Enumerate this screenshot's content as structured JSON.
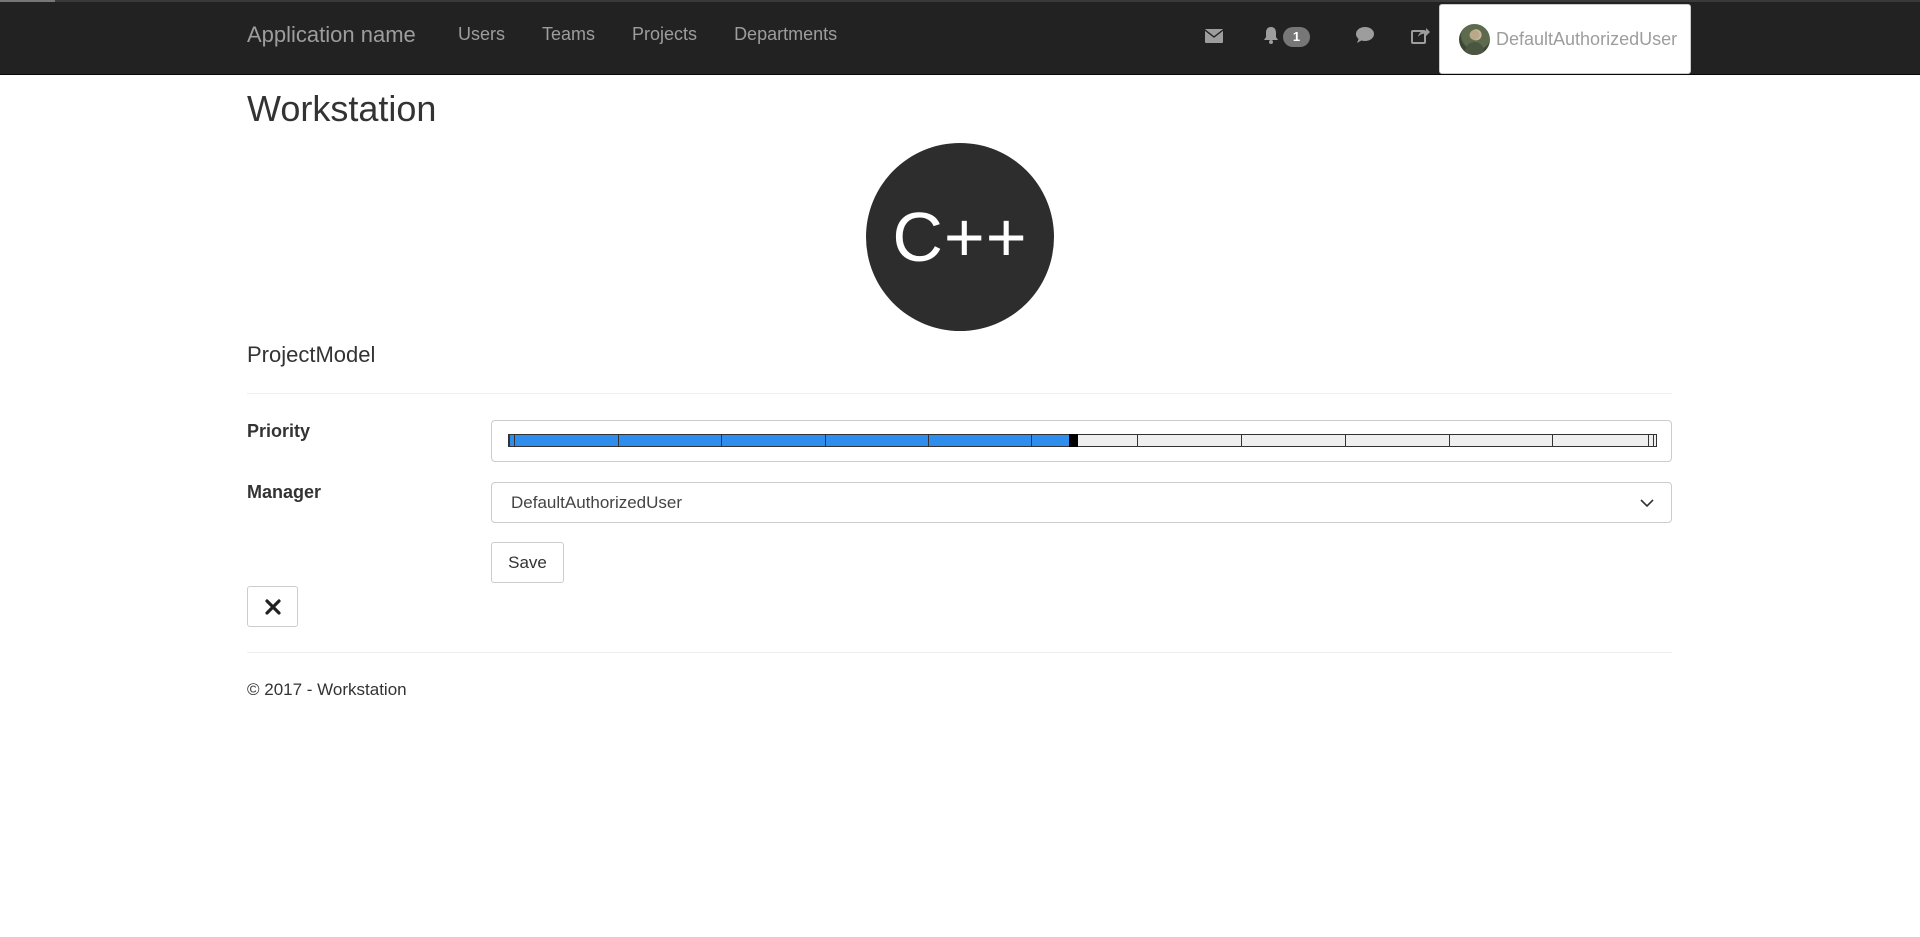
{
  "navbar": {
    "brand": "Application name",
    "links": [
      "Users",
      "Teams",
      "Projects",
      "Departments"
    ],
    "icons": [
      "envelope-icon",
      "bell-icon",
      "comment-icon",
      "share-icon"
    ],
    "notification_count": "1",
    "user_name": "DefaultAuthorizedUser"
  },
  "page": {
    "title": "Workstation",
    "project_initials": "C++",
    "section_title": "ProjectModel"
  },
  "form": {
    "priority_label": "Priority",
    "priority": {
      "value": 6,
      "max": 12,
      "segments": 11
    },
    "manager_label": "Manager",
    "manager_value": "DefaultAuthorizedUser",
    "save_label": "Save"
  },
  "footer": {
    "text": "© 2017 - Workstation"
  },
  "colors": {
    "navbar_bg": "#222222",
    "accent_fill": "#2f8ded",
    "circle_bg": "#2d2d2d"
  }
}
